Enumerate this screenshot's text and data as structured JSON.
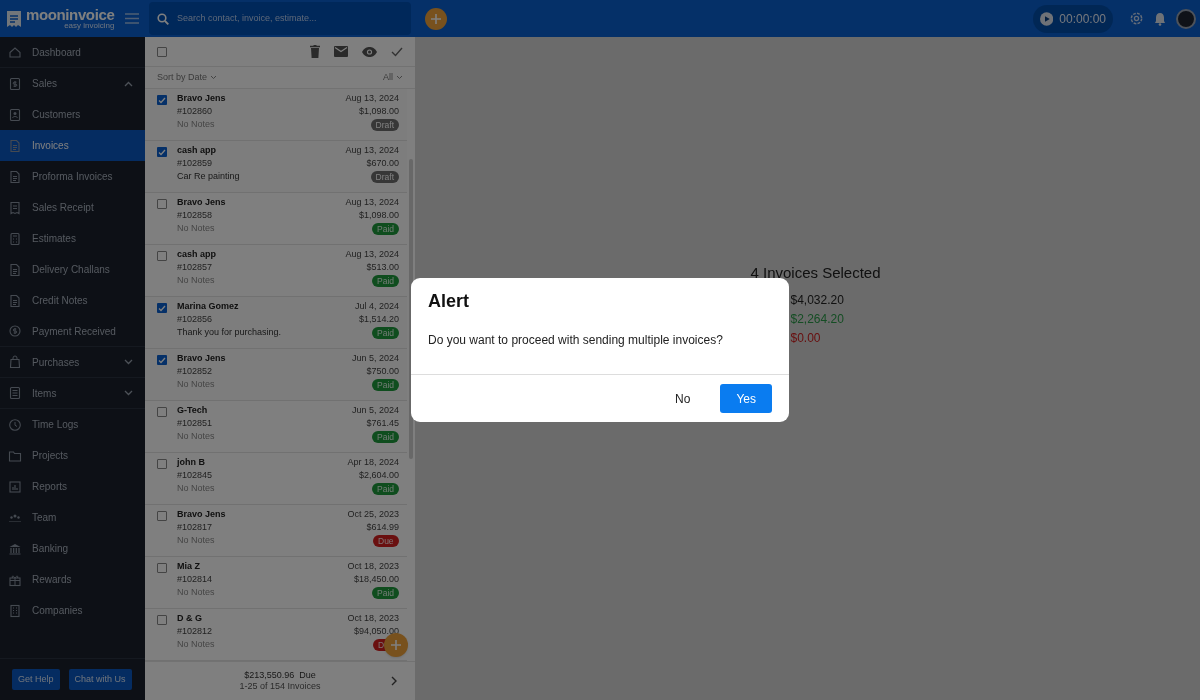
{
  "app": {
    "logo": "mooninvoice",
    "tagline": "easy invoicing"
  },
  "search": {
    "placeholder": "Search contact, invoice, estimate..."
  },
  "timer": "00:00:00",
  "sidebar": {
    "items": [
      {
        "label": "Dashboard",
        "selected": false
      },
      {
        "label": "Sales",
        "selected": false,
        "expanded": true,
        "children": [
          {
            "label": "Customers",
            "selected": false
          },
          {
            "label": "Invoices",
            "selected": true
          },
          {
            "label": "Proforma Invoices",
            "selected": false
          },
          {
            "label": "Sales Receipt",
            "selected": false
          },
          {
            "label": "Estimates",
            "selected": false
          },
          {
            "label": "Delivery Challans",
            "selected": false
          },
          {
            "label": "Credit Notes",
            "selected": false
          },
          {
            "label": "Payment Received",
            "selected": false
          }
        ]
      },
      {
        "label": "Purchases",
        "selected": false,
        "expanded": false
      },
      {
        "label": "Items",
        "selected": false,
        "expanded": false
      },
      {
        "label": "Time Logs",
        "selected": false
      },
      {
        "label": "Projects",
        "selected": false
      },
      {
        "label": "Reports",
        "selected": false
      },
      {
        "label": "Team",
        "selected": false
      },
      {
        "label": "Banking",
        "selected": false
      },
      {
        "label": "Rewards",
        "selected": false
      },
      {
        "label": "Companies",
        "selected": false
      }
    ],
    "buttons": [
      "Get Help",
      "Chat with Us"
    ]
  },
  "list": {
    "select_all": {
      "checked": false
    },
    "sort": "Sort by Date",
    "filter": "All",
    "rows": [
      {
        "name": "Bravo Jens",
        "number": "#102860",
        "date": "Aug 13, 2024",
        "amount": "$1,098.00",
        "notes": "No Notes",
        "has_notes": false,
        "status": {
          "text": "Draft",
          "kind": "draft"
        },
        "checked": true
      },
      {
        "name": "cash app",
        "number": "#102859",
        "date": "Aug 13, 2024",
        "amount": "$670.00",
        "notes": "Car Re painting",
        "has_notes": true,
        "status": {
          "text": "Draft",
          "kind": "draft"
        },
        "checked": true
      },
      {
        "name": "Bravo Jens",
        "number": "#102858",
        "date": "Aug 13, 2024",
        "amount": "$1,098.00",
        "notes": "No Notes",
        "has_notes": false,
        "status": {
          "text": "Paid",
          "kind": "paid"
        },
        "checked": false
      },
      {
        "name": "cash app",
        "number": "#102857",
        "date": "Aug 13, 2024",
        "amount": "$513.00",
        "notes": "No Notes",
        "has_notes": false,
        "status": {
          "text": "Paid",
          "kind": "paid"
        },
        "checked": false
      },
      {
        "name": "Marina Gomez",
        "number": "#102856",
        "date": "Jul 4, 2024",
        "amount": "$1,514.20",
        "notes": "Thank you for purchasing.",
        "has_notes": true,
        "status": {
          "text": "Paid",
          "kind": "paid"
        },
        "checked": true
      },
      {
        "name": "Bravo Jens",
        "number": "#102852",
        "date": "Jun 5, 2024",
        "amount": "$750.00",
        "notes": "No Notes",
        "has_notes": false,
        "status": {
          "text": "Paid",
          "kind": "paid"
        },
        "checked": true
      },
      {
        "name": "G-Tech",
        "number": "#102851",
        "date": "Jun 5, 2024",
        "amount": "$761.45",
        "notes": "No Notes",
        "has_notes": false,
        "status": {
          "text": "Paid",
          "kind": "paid"
        },
        "checked": false
      },
      {
        "name": "john B",
        "number": "#102845",
        "date": "Apr 18, 2024",
        "amount": "$2,604.00",
        "notes": "No Notes",
        "has_notes": false,
        "status": {
          "text": "Paid",
          "kind": "paid"
        },
        "checked": false
      },
      {
        "name": "Bravo Jens",
        "number": "#102817",
        "date": "Oct 25, 2023",
        "amount": "$614.99",
        "notes": "No Notes",
        "has_notes": false,
        "status": {
          "text": "Due",
          "kind": "due"
        },
        "checked": false
      },
      {
        "name": "Mia Z",
        "number": "#102814",
        "date": "Oct 18, 2023",
        "amount": "$18,450.00",
        "notes": "No Notes",
        "has_notes": false,
        "status": {
          "text": "Paid",
          "kind": "paid"
        },
        "checked": false
      },
      {
        "name": "D & G",
        "number": "#102812",
        "date": "Oct 18, 2023",
        "amount": "$94,050.00",
        "notes": "No Notes",
        "has_notes": false,
        "status": {
          "text": "D",
          "kind": "due"
        },
        "checked": false
      }
    ],
    "footer": {
      "due": "$213,550.96  Due",
      "range": "1-25 of 154 Invoices"
    }
  },
  "summary": {
    "title": "4 Invoices Selected",
    "amounts": [
      {
        "text": "$4,032.20",
        "kind": "total"
      },
      {
        "text": "$2,264.20",
        "kind": "paid"
      },
      {
        "text": "$0.00",
        "kind": "due"
      }
    ]
  },
  "dialog": {
    "title": "Alert",
    "message": "Do you want to proceed with sending multiple invoices?",
    "buttons": [
      {
        "label": "No",
        "kind": "text"
      },
      {
        "label": "Yes",
        "kind": "primary"
      }
    ]
  }
}
